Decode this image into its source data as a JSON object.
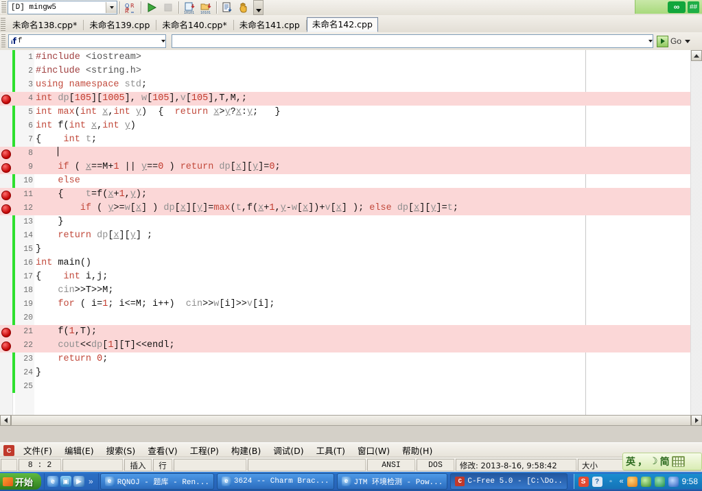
{
  "toolbar": {
    "compiler_combo_value": "[D] mingw5",
    "buttons": [
      {
        "name": "find-replace-button",
        "label": "Find/Replace"
      },
      {
        "name": "run-button",
        "label": "Run"
      },
      {
        "name": "stop-button",
        "label": "Stop"
      },
      {
        "name": "compile-button",
        "label": "Compile"
      },
      {
        "name": "build-run-button",
        "label": "Build and Run"
      },
      {
        "name": "build-log-button",
        "label": "Build Log"
      },
      {
        "name": "pause-button",
        "label": "Pause"
      }
    ],
    "overflow_label": "More toolbar buttons",
    "green_badge": {
      "left": "∞",
      "right": "##"
    }
  },
  "tabs": [
    {
      "label": "未命名138.cpp*",
      "selected": false
    },
    {
      "label": "未命名139.cpp",
      "selected": false
    },
    {
      "label": "未命名140.cpp*",
      "selected": false
    },
    {
      "label": "未命名141.cpp",
      "selected": false
    },
    {
      "label": "未命名142.cpp",
      "selected": true
    }
  ],
  "findbar": {
    "find_icon_label": "ᵢf",
    "find_value": "f",
    "goto_value": "",
    "go_label": "Go"
  },
  "editor": {
    "margin_column_line": true,
    "lines": [
      {
        "n": "1",
        "text": "#include <iostream>",
        "hl": false,
        "bp": false
      },
      {
        "n": "2",
        "text": "#include <string.h>",
        "hl": false,
        "bp": false
      },
      {
        "n": "3",
        "text": "using namespace std;",
        "hl": false,
        "bp": false
      },
      {
        "n": "4",
        "text": "int dp[105][1005], w[105],v[105],T,M,;",
        "hl": true,
        "bp": true
      },
      {
        "n": "5",
        "text": "int max(int x,int y)  {  return x>y?x:y;   }",
        "hl": false,
        "bp": false
      },
      {
        "n": "6",
        "text": "int f(int x,int y)",
        "hl": false,
        "bp": false
      },
      {
        "n": "7",
        "text": "{    int t;",
        "hl": false,
        "bp": false
      },
      {
        "n": "8",
        "text": "    ",
        "hl": true,
        "bp": true
      },
      {
        "n": "9",
        "text": "    if ( x==M+1 || y==0 ) return dp[x][y]=0;",
        "hl": true,
        "bp": true
      },
      {
        "n": "10",
        "text": "    else",
        "hl": false,
        "bp": false
      },
      {
        "n": "11",
        "text": "    {    t=f(x+1,y);",
        "hl": true,
        "bp": true
      },
      {
        "n": "12",
        "text": "        if ( y>=w[x] ) dp[x][y]=max(t,f(x+1,y-w[x])+v[x] ); else dp[x][y]=t;",
        "hl": true,
        "bp": true
      },
      {
        "n": "13",
        "text": "    }",
        "hl": false,
        "bp": false
      },
      {
        "n": "14",
        "text": "    return dp[x][y] ;",
        "hl": false,
        "bp": false
      },
      {
        "n": "15",
        "text": "}",
        "hl": false,
        "bp": false
      },
      {
        "n": "16",
        "text": "int main()",
        "hl": false,
        "bp": false
      },
      {
        "n": "17",
        "text": "{    int i,j;",
        "hl": false,
        "bp": false
      },
      {
        "n": "18",
        "text": "    cin>>T>>M;",
        "hl": false,
        "bp": false
      },
      {
        "n": "19",
        "text": "    for ( i=1; i<=M; i++)  cin>>w[i]>>v[i];",
        "hl": false,
        "bp": false
      },
      {
        "n": "20",
        "text": "",
        "hl": false,
        "bp": false
      },
      {
        "n": "21",
        "text": "    f(1,T);",
        "hl": true,
        "bp": true
      },
      {
        "n": "22",
        "text": "    cout<<dp[1][T]<<endl;",
        "hl": true,
        "bp": true
      },
      {
        "n": "23",
        "text": "    return 0;",
        "hl": false,
        "bp": false
      },
      {
        "n": "24",
        "text": "}",
        "hl": false,
        "bp": false
      },
      {
        "n": "25",
        "text": "",
        "hl": false,
        "bp": false
      }
    ]
  },
  "menubar": {
    "items": [
      {
        "name": "menu-file",
        "label": "文件(F)"
      },
      {
        "name": "menu-edit",
        "label": "编辑(E)"
      },
      {
        "name": "menu-search",
        "label": "搜索(S)"
      },
      {
        "name": "menu-view",
        "label": "查看(V)"
      },
      {
        "name": "menu-project",
        "label": "工程(P)"
      },
      {
        "name": "menu-build",
        "label": "构建(B)"
      },
      {
        "name": "menu-debug",
        "label": "调试(D)"
      },
      {
        "name": "menu-tools",
        "label": "工具(T)"
      },
      {
        "name": "menu-window",
        "label": "窗口(W)"
      },
      {
        "name": "menu-help",
        "label": "帮助(H)"
      }
    ]
  },
  "statusbar": {
    "cursor_position": "8 : 2",
    "blank1": "",
    "insert_mode": "插入",
    "line_mode": "行",
    "blank2": "",
    "blank3": "",
    "encoding": "ANSI",
    "line_ending": "DOS",
    "modified": "修改: 2013-8-16, 9:58:42",
    "size_label": "大小"
  },
  "ime": {
    "lang": "英",
    "punct": "，",
    "moon": "☽",
    "script": "简",
    "keyboard_label": "soft-keyboard"
  },
  "taskbar": {
    "start_label": "开始",
    "quicklaunch": [
      {
        "name": "ql-internet-explorer",
        "glyph": "e"
      },
      {
        "name": "ql-show-desktop",
        "glyph": "▣"
      },
      {
        "name": "ql-media-player",
        "glyph": "▶"
      }
    ],
    "quicklaunch_overflow": "»",
    "windows": [
      {
        "name": "taskbar-item-rqnoj",
        "label": "RQNOJ - 题库 - Ren...",
        "glyph": "e",
        "active": false
      },
      {
        "name": "taskbar-item-3624",
        "label": "3624 -- Charm Brac...",
        "glyph": "e",
        "active": false
      },
      {
        "name": "taskbar-item-jtm",
        "label": "JTM 环境检测 - Pow...",
        "glyph": "e",
        "active": false
      },
      {
        "name": "taskbar-item-cfree",
        "label": "C-Free 5.0 - [C:\\Do..",
        "glyph": "C",
        "active": true
      }
    ],
    "tray_extra": [
      {
        "name": "tray-sogou-icon",
        "glyph": "S"
      },
      {
        "name": "tray-help-icon",
        "glyph": "?"
      },
      {
        "name": "tray-restore-icon",
        "glyph": "▫"
      }
    ],
    "tray_chevron": "«",
    "tray_icons": [
      "tray-update-icon",
      "tray-shield-icon",
      "tray-antivirus-icon",
      "tray-network-icon"
    ],
    "clock": "9:58"
  },
  "colors": {
    "highlight_row": "#fbd7d7",
    "breakpoint": "#c00000",
    "change_bar": "#2ee02e",
    "taskbar": "#2663b8",
    "accent_green": "#12a63c"
  }
}
